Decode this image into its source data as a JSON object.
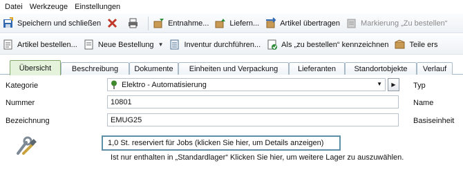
{
  "menu": [
    "Datei",
    "Werkzeuge",
    "Einstellungen"
  ],
  "toolbar1": {
    "save_close": "Speichern und schließen",
    "entnahme": "Entnahme...",
    "liefern": "Liefern...",
    "artikel_uebertragen": "Artikel übertragen",
    "markierung": "Markierung „Zu bestellen“"
  },
  "toolbar2": {
    "artikel_bestellen": "Artikel bestellen...",
    "neue_bestellung": "Neue Bestellung",
    "inventur": "Inventur durchführen...",
    "als_zu_bestellen": "Als „zu bestellen“ kennzeichnen",
    "teile": "Teile ers"
  },
  "tabs": [
    "Übersicht",
    "Beschreibung",
    "Dokumente",
    "Einheiten und Verpackung",
    "Lieferanten",
    "Standortobjekte",
    "Verlauf"
  ],
  "active_tab": "Übersicht",
  "form": {
    "kategorie_label": "Kategorie",
    "kategorie_value": "Elektro - Automatisierung",
    "nummer_label": "Nummer",
    "nummer_value": "10801",
    "bezeichnung_label": "Bezeichnung",
    "bezeichnung_value": "EMUG25",
    "right_labels": [
      "Typ",
      "Name",
      "Basiseinheit"
    ]
  },
  "reserved_text": "1,0 St. reserviert für Jobs (klicken Sie hier, um Details anzeigen)",
  "info_text": "Ist nur enthalten in „Standardlager“ Klicken Sie hier, um weitere Lager zu auszuwählen.",
  "colors": {
    "active_tab_bg": "#e6f3dc",
    "reserved_border": "#5f8fa8",
    "pin_green": "#3f8a2e"
  }
}
